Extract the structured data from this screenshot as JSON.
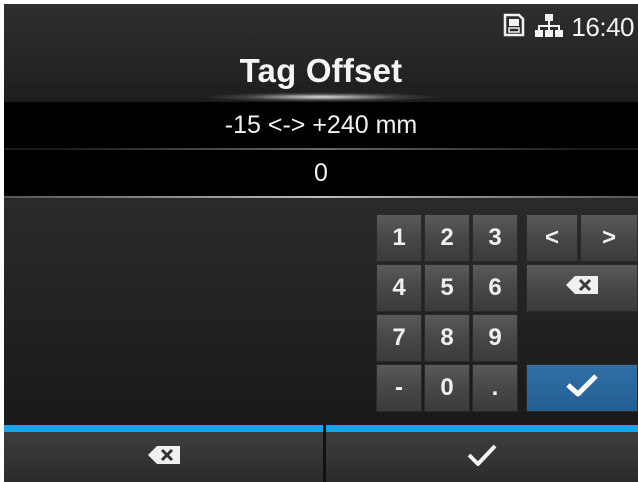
{
  "status": {
    "time": "16:40",
    "icons": [
      "sd-card-icon",
      "network-icon"
    ]
  },
  "title": "Tag Offset",
  "range": "-15 <-> +240 mm",
  "value": "0",
  "keypad": {
    "keys": [
      "1",
      "2",
      "3",
      "4",
      "5",
      "6",
      "7",
      "8",
      "9",
      "-",
      "0",
      "."
    ],
    "left_label": "<",
    "right_label": ">",
    "backspace_icon": "backspace-icon",
    "enter_icon": "check-icon"
  },
  "bottom": {
    "left_icon": "backspace-icon",
    "right_icon": "check-icon"
  },
  "colors": {
    "accent_blue": "#1aa3e8",
    "enter_key": "#2a68a0",
    "background": "#1c1c1c"
  }
}
